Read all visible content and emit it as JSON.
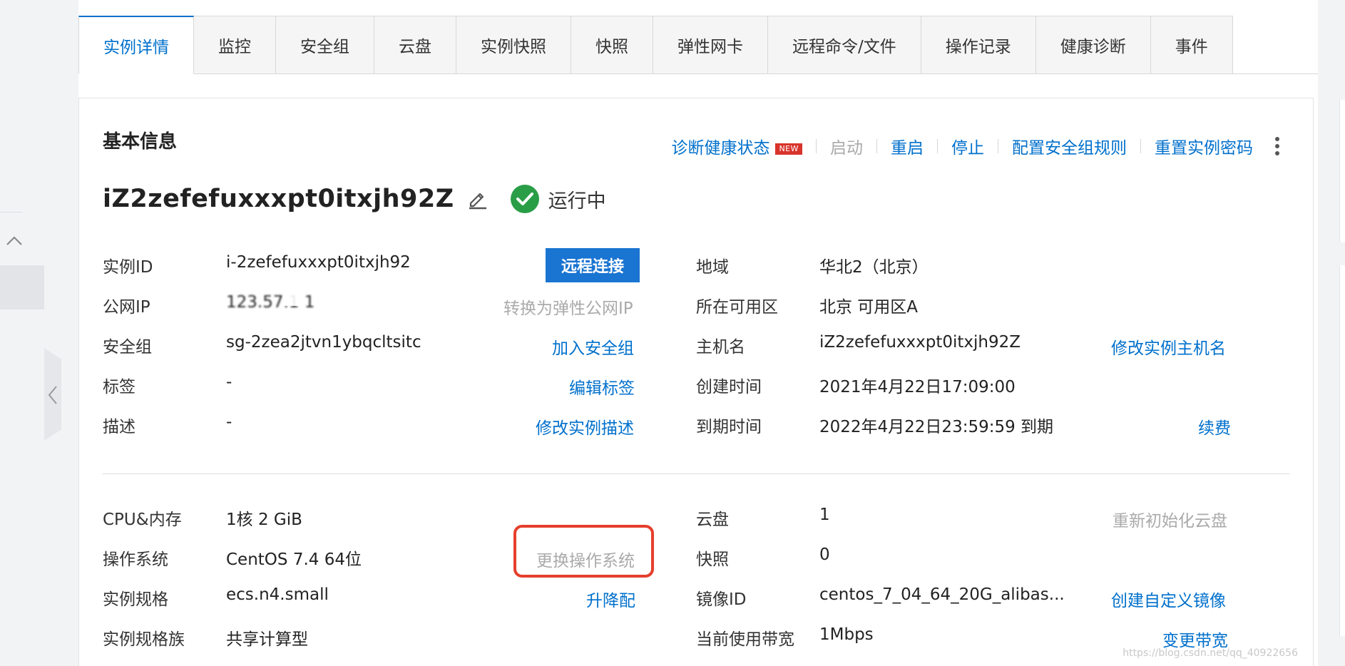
{
  "tabs": [
    {
      "label": "实例详情",
      "active": true
    },
    {
      "label": "监控"
    },
    {
      "label": "安全组"
    },
    {
      "label": "云盘"
    },
    {
      "label": "实例快照"
    },
    {
      "label": "快照"
    },
    {
      "label": "弹性网卡"
    },
    {
      "label": "远程命令/文件"
    },
    {
      "label": "操作记录"
    },
    {
      "label": "健康诊断"
    },
    {
      "label": "事件"
    }
  ],
  "section": {
    "title": "基本信息"
  },
  "actions": {
    "diagnose": "诊断健康状态",
    "new_badge": "NEW",
    "start": "启动",
    "restart": "重启",
    "stop": "停止",
    "config_sg_rules": "配置安全组规则",
    "reset_password": "重置实例密码"
  },
  "instance": {
    "name": "iZ2zefefuxxxpt0itxjh92Z",
    "status": "运行中"
  },
  "left_info": {
    "instance_id": {
      "label": "实例ID",
      "value": "i-2zefefuxxxpt0itxjh92",
      "action": "远程连接"
    },
    "public_ip": {
      "label": "公网IP",
      "value": "123.57.1   1",
      "action": "转换为弹性公网IP"
    },
    "security_group": {
      "label": "安全组",
      "value": "sg-2zea2jtvn1ybqcltsitc",
      "action": "加入安全组"
    },
    "tags": {
      "label": "标签",
      "value": "-",
      "action": "编辑标签"
    },
    "description": {
      "label": "描述",
      "value": "-",
      "action": "修改实例描述"
    }
  },
  "right_info": {
    "region": {
      "label": "地域",
      "value": "华北2（北京）"
    },
    "zone": {
      "label": "所在可用区",
      "value": "北京 可用区A"
    },
    "hostname": {
      "label": "主机名",
      "value": "iZ2zefefuxxxpt0itxjh92Z",
      "action": "修改实例主机名"
    },
    "created": {
      "label": "创建时间",
      "value": "2021年4月22日17:09:00"
    },
    "expires": {
      "label": "到期时间",
      "value": "2022年4月22日23:59:59 到期",
      "action": "续费"
    }
  },
  "left_config": {
    "cpu_mem": {
      "label": "CPU&内存",
      "value": "1核 2 GiB"
    },
    "os": {
      "label": "操作系统",
      "value": "CentOS 7.4 64位",
      "action": "更换操作系统"
    },
    "spec": {
      "label": "实例规格",
      "value": "ecs.n4.small",
      "action": "升降配"
    },
    "spec_family": {
      "label": "实例规格族",
      "value": "共享计算型"
    }
  },
  "right_config": {
    "disk": {
      "label": "云盘",
      "value": "1",
      "action": "重新初始化云盘"
    },
    "snapshot": {
      "label": "快照",
      "value": "0"
    },
    "image_id": {
      "label": "镜像ID",
      "value": "centos_7_04_64_20G_alibas...",
      "action": "创建自定义镜像"
    },
    "bandwidth": {
      "label": "当前使用带宽",
      "value": "1Mbps",
      "action": "变更带宽"
    }
  },
  "watermark": "https://blog.csdn.net/qq_40922656",
  "colors": {
    "link": "#0070cc",
    "primary_button": "#1a74d1",
    "highlight": "#e53f2c",
    "status_ok": "#2a9d47"
  }
}
